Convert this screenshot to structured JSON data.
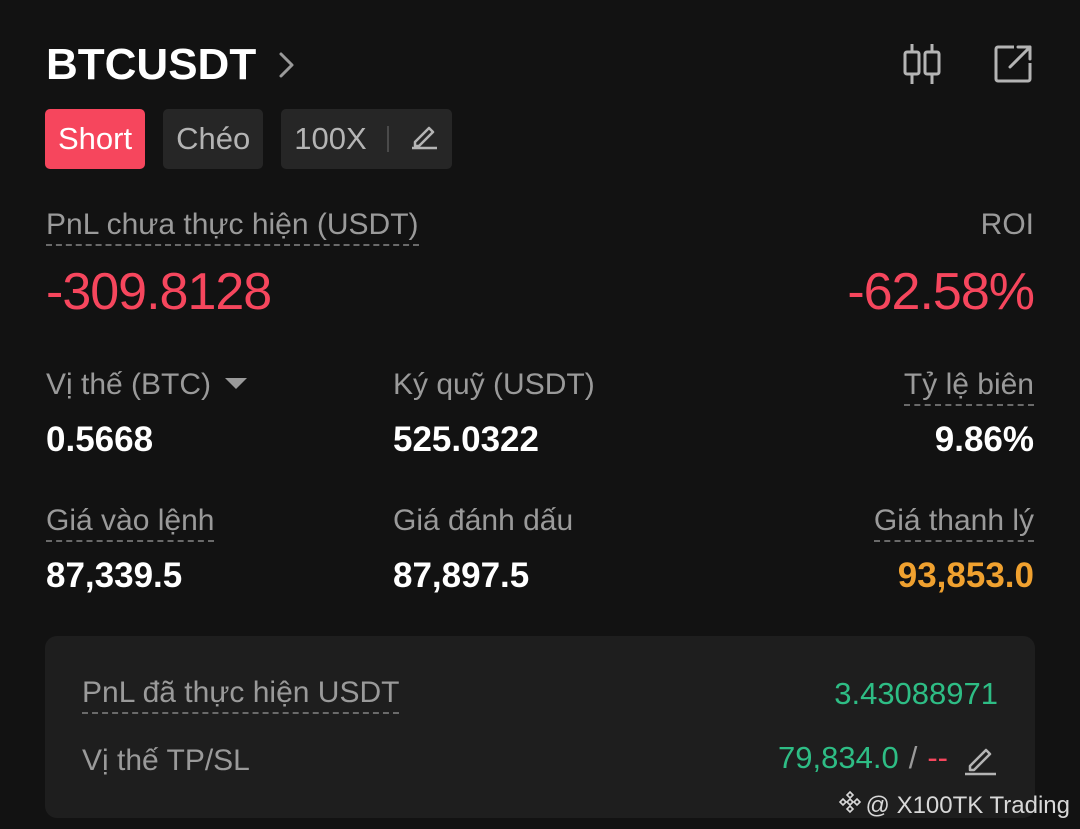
{
  "header": {
    "symbol": "BTCUSDT"
  },
  "tags": {
    "side": "Short",
    "margin_mode": "Chéo",
    "leverage": "100X"
  },
  "pnl": {
    "unrealized_label": "PnL chưa thực hiện (USDT)",
    "unrealized_value": "-309.8128",
    "roi_label": "ROI",
    "roi_value": "-62.58%"
  },
  "stats": {
    "position_label": "Vị thế (BTC)",
    "position_value": "0.5668",
    "margin_label": "Ký quỹ (USDT)",
    "margin_value": "525.0322",
    "margin_ratio_label": "Tỷ lệ biên",
    "margin_ratio_value": "9.86%",
    "entry_label": "Giá vào lệnh",
    "entry_value": "87,339.5",
    "mark_label": "Giá đánh dấu",
    "mark_value": "87,897.5",
    "liq_label": "Giá thanh lý",
    "liq_value": "93,853.0"
  },
  "panel": {
    "realized_label": "PnL đã thực hiện USDT",
    "realized_value": "3.43088971",
    "tpsl_label": "Vị thế TP/SL",
    "tp_value": "79,834.0",
    "separator": "/",
    "sl_value": "--"
  },
  "watermark": {
    "text": "@ X100TK Trading"
  },
  "colors": {
    "background": "#121212",
    "negative": "#f6465d",
    "positive": "#2ebd85",
    "liquidation": "#f0a12f",
    "muted": "#9a9a9a"
  },
  "icons": [
    "chevron-right-icon",
    "candlestick-chart-icon",
    "share-external-icon",
    "edit-pencil-icon",
    "caret-down-icon",
    "binance-logo-icon"
  ]
}
